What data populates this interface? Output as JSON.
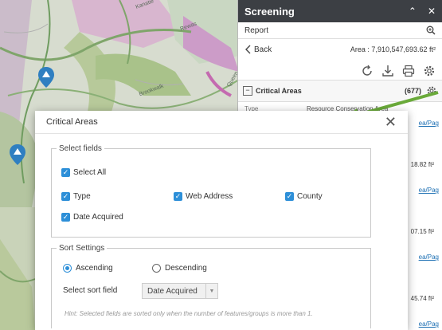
{
  "map": {
    "labels": [
      "Kanatie",
      "Rewas",
      "Queen",
      "Brookwalk"
    ]
  },
  "panel": {
    "title": "Screening",
    "collapse_glyph": "⌃",
    "close_glyph": "✕",
    "report_label": "Report",
    "back_label": "Back",
    "area_text": "Area : 7,910,547,693.62 ft²",
    "critical_areas_label": "Critical Areas",
    "critical_areas_count": "(677)",
    "row_type_label": "Type",
    "row_type_value": "Resource Conservation Area",
    "link_text": "ea/Pag",
    "side_values": [
      "18.82 ft²",
      "07.15 ft²",
      "45.74 ft²"
    ]
  },
  "dialog": {
    "title": "Critical Areas",
    "select_fields_legend": "Select fields",
    "select_all_label": "Select All",
    "fields": [
      "Type",
      "Web Address",
      "County",
      "Date Acquired"
    ],
    "sort_legend": "Sort Settings",
    "ascending_label": "Ascending",
    "descending_label": "Descending",
    "sort_field_label": "Select sort field",
    "sort_field_value": "Date Acquired",
    "hint": "Hint: Selected fields are sorted only when the number of features/groups is more than 1."
  },
  "colors": {
    "accent": "#2d8fd8",
    "header": "#3c3f44",
    "arrow": "#6aaa3a"
  }
}
